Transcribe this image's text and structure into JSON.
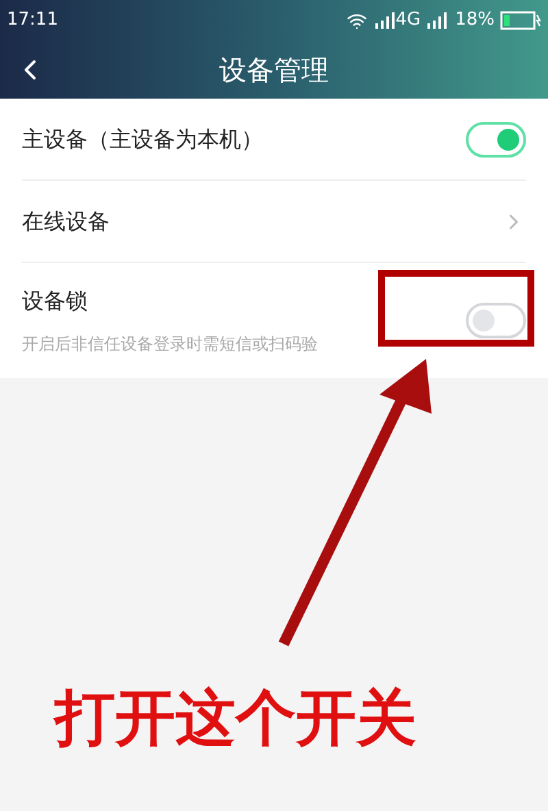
{
  "status_bar": {
    "time": "17:11",
    "network": "4G",
    "battery": "18%"
  },
  "header": {
    "title": "设备管理"
  },
  "settings": [
    {
      "kind": "toggle",
      "label": "主设备（主设备为本机）",
      "on": true
    },
    {
      "kind": "link",
      "label": "在线设备"
    },
    {
      "kind": "toggle",
      "label": "设备锁",
      "description": "开启后非信任设备登录时需短信或扫码验",
      "on": false
    }
  ],
  "annotation": {
    "text": "打开这个开关"
  }
}
